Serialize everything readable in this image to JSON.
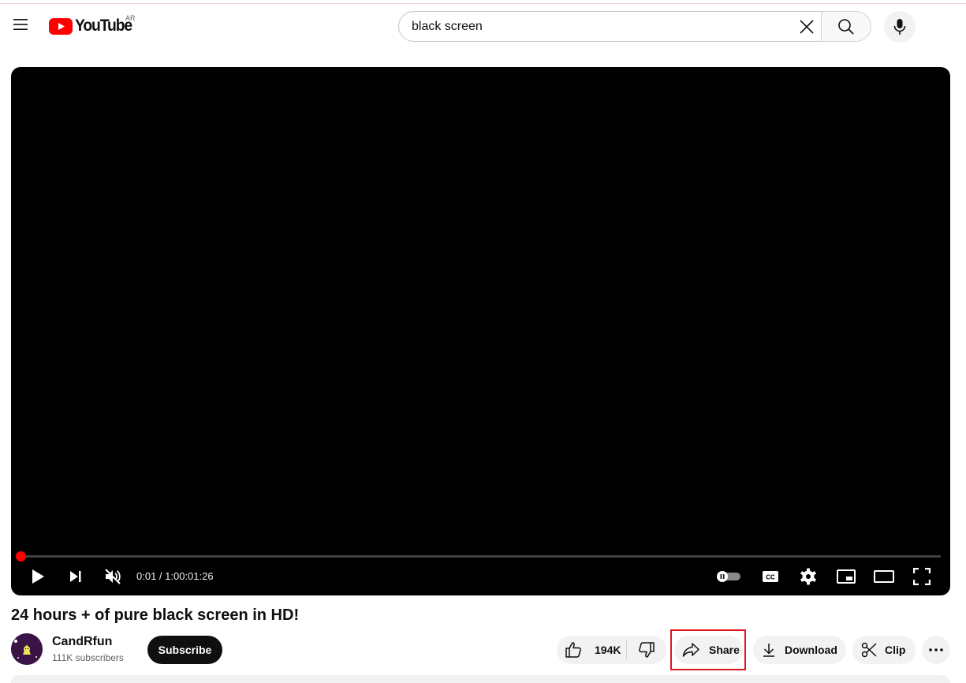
{
  "header": {
    "logo_text": "YouTube",
    "country_code": "AR",
    "search": {
      "value": "black screen",
      "placeholder": "Search"
    }
  },
  "player": {
    "time_current": "0:01",
    "time_total": "1:00:01:26",
    "time_display": "0:01 / 1:00:01:26",
    "progress_fraction": 0.00028,
    "muted": true,
    "autoplay": "off",
    "accent_color": "#ff0000"
  },
  "video": {
    "title": "24 hours + of pure black screen in HD!"
  },
  "channel": {
    "name": "CandRfun",
    "subscribers": "111K subscribers",
    "subscribe_label": "Subscribe"
  },
  "actions": {
    "like_count": "194K",
    "share_label": "Share",
    "download_label": "Download",
    "clip_label": "Clip",
    "highlight_color": "#e0161e"
  },
  "icons": {
    "menu": "hamburger-menu-icon",
    "logo": "youtube-play-icon",
    "clear": "close-icon",
    "search": "search-icon",
    "mic": "microphone-icon",
    "play": "play-icon",
    "next": "next-icon",
    "mute": "volume-muted-icon",
    "autoplay": "autoplay-toggle-icon",
    "captions": "captions-icon",
    "settings": "gear-icon",
    "miniplayer": "miniplayer-icon",
    "theater": "theater-mode-icon",
    "fullscreen": "fullscreen-icon",
    "like": "thumbs-up-icon",
    "dislike": "thumbs-down-icon",
    "share": "share-arrow-icon",
    "download": "download-icon",
    "clip": "scissors-icon",
    "more": "more-horizontal-icon"
  }
}
